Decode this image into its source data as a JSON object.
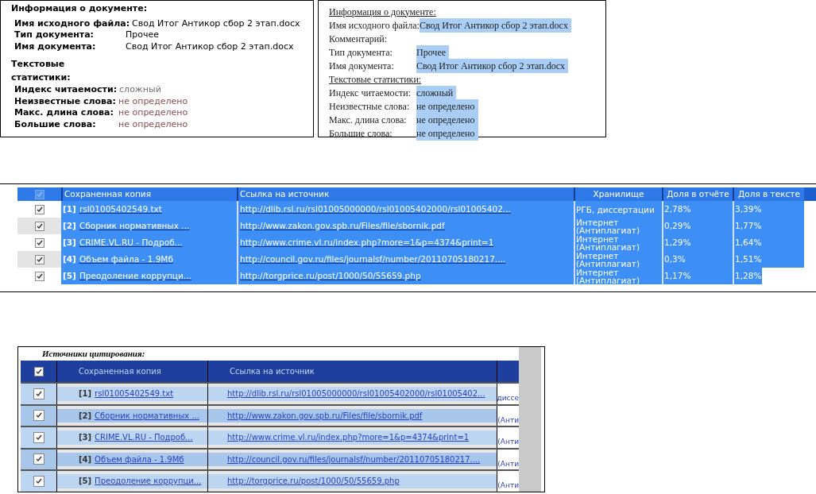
{
  "doc_info_plain": {
    "title": "Информация о документе:",
    "fields": [
      {
        "label": "Имя исходного файла:",
        "value": "Свод Итог Антикор сбор 2 этап.docx"
      },
      {
        "label": "Тип документа:",
        "value": "Прочее"
      },
      {
        "label": "Имя документа:",
        "value": "Свод Итог Антикор сбор 2 этап.docx"
      }
    ],
    "stats_title": "Текстовые статистики:",
    "stats": [
      {
        "label": "Индекс читаемости:",
        "value": "сложный",
        "color": "#707070"
      },
      {
        "label": "Неизвестные слова:",
        "value": "не определено",
        "color": "#8a4f55"
      },
      {
        "label": "Макс. длина слова:",
        "value": "не определено",
        "color": "#8a4f55"
      },
      {
        "label": "Большие слова:",
        "value": "не определено",
        "color": "#8a4f55"
      }
    ]
  },
  "doc_info_word": {
    "title": "Информация о документе:",
    "fields": [
      {
        "label": "Имя исходного файла:",
        "value": "Свод Итог Антикор сбор 2 этап.docx"
      },
      {
        "label": "Комментарий:"
      },
      {
        "label": "Тип документа:",
        "value": "Прочее"
      },
      {
        "label": "Имя документа:",
        "value": "Свод Итог Антикор сбор 2 этап.docx"
      }
    ],
    "stats_title": "Текстовые статистики:",
    "stats": [
      {
        "label": "Индекс читаемости:",
        "value": "сложный"
      },
      {
        "label": "Неизвестные слова:",
        "value": "не определено"
      },
      {
        "label": "Макс. длина слова:",
        "value": "не определено"
      },
      {
        "label": "Большие слова:",
        "value": "не определено"
      }
    ]
  },
  "sources_table": {
    "header_checked": true,
    "columns": [
      "Сохраненная копия",
      "Ссылка на источник",
      "Хранилище",
      "Доля в отчёте",
      "Доля в тексте"
    ],
    "rows": [
      {
        "checked": true,
        "number": "[1]",
        "copy": "rsl01005402549.txt",
        "link": "http://dlib.rsl.ru/rsl01005000000/rsl01005402000/rsl01005402...",
        "storage": "РГБ, диссертации",
        "report_share": "2,78%",
        "text_share": "3,39%"
      },
      {
        "checked": true,
        "number": "[2]",
        "copy": "Сборник нормативных ...",
        "link": "http://www.zakon.gov.spb.ru/Files/file/sbornik.pdf",
        "storage": "Интернет (Антиплагиат)",
        "report_share": "0,29%",
        "text_share": "1,77%"
      },
      {
        "checked": true,
        "number": "[3]",
        "copy": "CRIME.VL.RU - Подроб...",
        "link": "http://www.crime.vl.ru/index.php?more=1&p=4374&print=1",
        "storage": "Интернет (Антиплагиат)",
        "report_share": "1,29%",
        "text_share": "1,64%"
      },
      {
        "checked": true,
        "number": "[4]",
        "copy": "Объем файла - 1.9Мб",
        "link": "http://council.gov.ru/files/journalsf/number/20110705180217....",
        "storage": "Интернет (Антиплагиат)",
        "report_share": "0,3%",
        "text_share": "1,51%"
      },
      {
        "checked": true,
        "number": "[5]",
        "copy": "Преодоление коррупци...",
        "link": "http://torgprice.ru/post/1000/50/55659.php",
        "storage": "Интернет (Антиплагиат)",
        "report_share": "1,17%",
        "text_share": "1,28%"
      }
    ]
  },
  "citation_sources": {
    "title": "Источники цитирования:",
    "header_checked": true,
    "columns": [
      "Сохраненная копия",
      "Ссылка на источник"
    ],
    "rows": [
      {
        "checked": true,
        "number": "[1]",
        "copy": "rsl01005402549.txt",
        "link": "http://dlib.rsl.ru/rsl01005000000/rsl01005402000/rsl01005402...",
        "storage": "диссе"
      },
      {
        "checked": true,
        "number": "[2]",
        "copy": "Сборник нормативных ...",
        "link": "http://www.zakon.gov.spb.ru/Files/file/sbornik.pdf",
        "storage": "(Анти"
      },
      {
        "checked": true,
        "number": "[3]",
        "copy": "CRIME.VL.RU - Подроб...",
        "link": "http://www.crime.vl.ru/index.php?more=1&p=4374&print=1",
        "storage": "(Анти"
      },
      {
        "checked": true,
        "number": "[4]",
        "copy": "Объем файла - 1.9Мб",
        "link": "http://council.gov.ru/files/journalsf/number/20110705180217....",
        "storage": "(Анти"
      },
      {
        "checked": true,
        "number": "[5]",
        "copy": "Преодоление коррупци...",
        "link": "http://torgprice.ru/post/1000/50/55659.php",
        "storage": "(Анти"
      }
    ]
  }
}
